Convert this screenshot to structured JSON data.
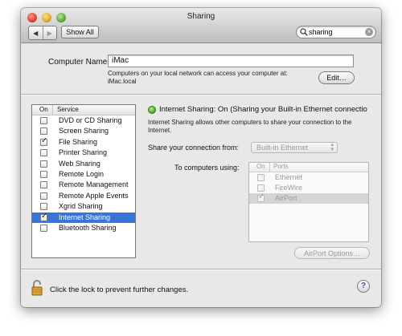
{
  "window": {
    "title": "Sharing"
  },
  "toolbar": {
    "back_icon": "back-arrow-icon",
    "forward_icon": "forward-arrow-icon",
    "show_all_label": "Show All",
    "search_value": "sharing"
  },
  "computer": {
    "name_label": "Computer Name:",
    "name_value": "iMac",
    "note_line1": "Computers on your local network can access your computer at:",
    "note_line2": "iMac.local",
    "edit_label": "Edit…"
  },
  "services": {
    "col_on": "On",
    "col_service": "Service",
    "items": [
      {
        "label": "DVD or CD Sharing",
        "checked": false
      },
      {
        "label": "Screen Sharing",
        "checked": false
      },
      {
        "label": "File Sharing",
        "checked": true
      },
      {
        "label": "Printer Sharing",
        "checked": false
      },
      {
        "label": "Web Sharing",
        "checked": false
      },
      {
        "label": "Remote Login",
        "checked": false
      },
      {
        "label": "Remote Management",
        "checked": false
      },
      {
        "label": "Remote Apple Events",
        "checked": false
      },
      {
        "label": "Xgrid Sharing",
        "checked": false
      },
      {
        "label": "Internet Sharing",
        "checked": true,
        "selected": true
      },
      {
        "label": "Bluetooth Sharing",
        "checked": false
      }
    ]
  },
  "detail": {
    "status_text": "Internet Sharing: On (Sharing your Built-in Ethernet connectio",
    "description_line1": "Internet Sharing allows other computers to share your connection to the",
    "description_line2": "Internet.",
    "share_from_label": "Share your connection from:",
    "share_from_value": "Built-in Ethernet",
    "to_computers_label": "To computers using:",
    "ports_col_on": "On",
    "ports_col_ports": "Ports",
    "ports": [
      {
        "label": "Ethernet",
        "checked": false
      },
      {
        "label": "FireWire",
        "checked": false
      },
      {
        "label": "AirPort",
        "checked": true,
        "selected": true
      }
    ],
    "airport_options_label": "AirPort Options…"
  },
  "footer": {
    "lock_text": "Click the lock to prevent further changes.",
    "help_label": "?"
  },
  "colors": {
    "selection": "#3875d7",
    "status_on": "#3fae1e",
    "disabled_text": "#9a9a9a"
  }
}
